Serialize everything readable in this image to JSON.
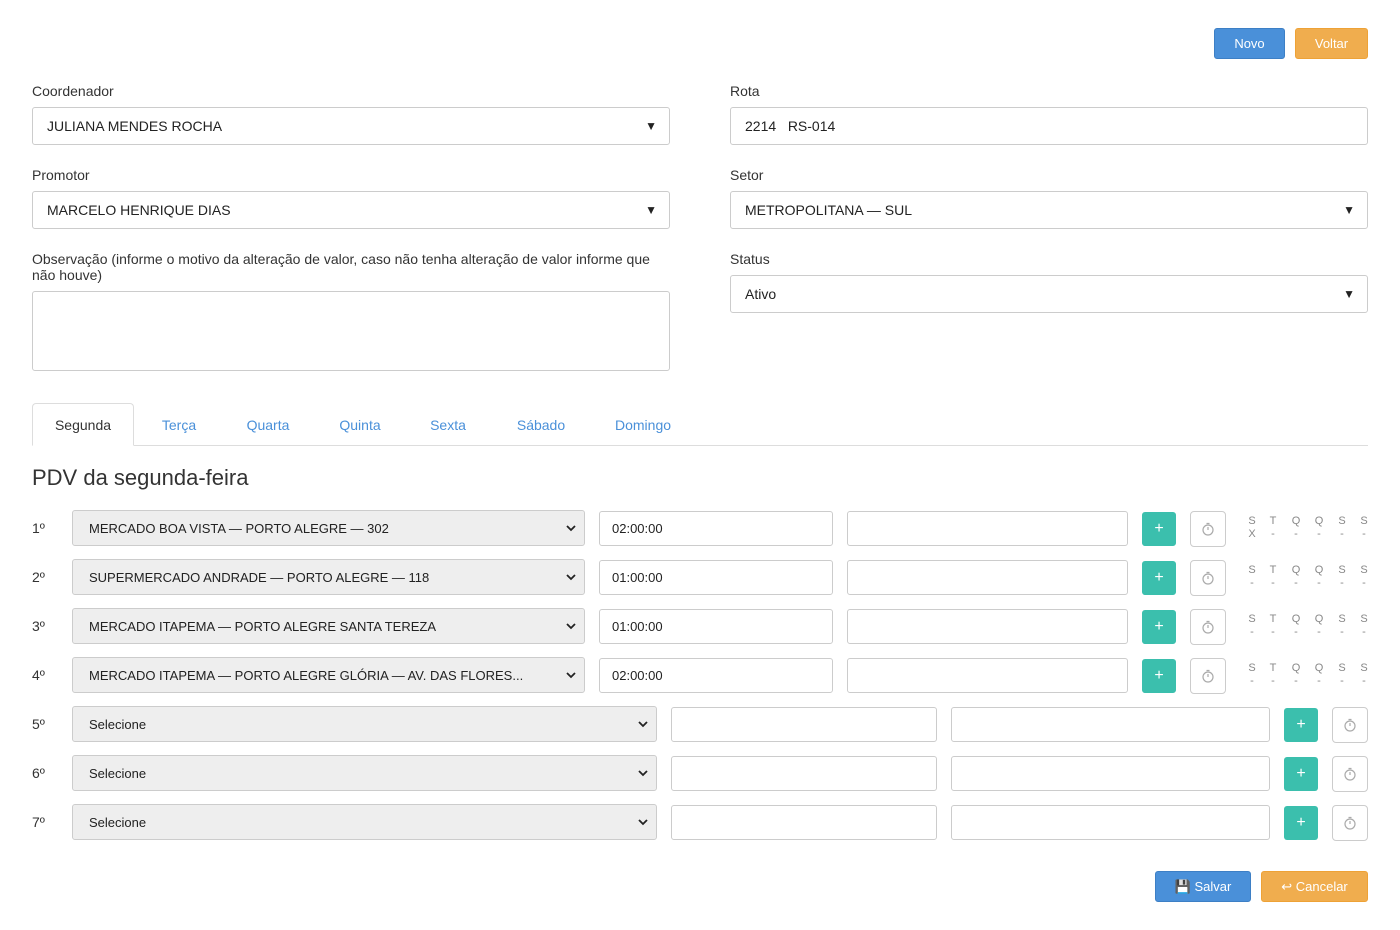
{
  "header": {
    "novo_label": "Novo",
    "voltar_label": "Voltar"
  },
  "form": {
    "coordenador": {
      "label": "Coordenador",
      "value": "JULIANA MENDES ROCHA"
    },
    "rota": {
      "label": "Rota",
      "value": "2214   RS-014"
    },
    "promotor": {
      "label": "Promotor",
      "value": "MARCELO HENRIQUE DIAS"
    },
    "setor": {
      "label": "Setor",
      "value": "METROPOLITANA — SUL"
    },
    "observacao": {
      "label": "Observação (informe o motivo da alteração de valor, caso não tenha alteração de valor informe que não houve)",
      "value": ""
    },
    "status": {
      "label": "Status",
      "value": "Ativo"
    }
  },
  "tabs": [
    "Segunda",
    "Terça",
    "Quarta",
    "Quinta",
    "Sexta",
    "Sábado",
    "Domingo"
  ],
  "section_title": "PDV da segunda-feira",
  "pdv_rows": [
    {
      "num": "1º",
      "pdv": "MERCADO BOA VISTA — PORTO ALEGRE — 302",
      "time": "02:00:00",
      "note": "",
      "day_marks": [
        "X",
        "-",
        "-",
        "-",
        "-",
        "-"
      ]
    },
    {
      "num": "2º",
      "pdv": "SUPERMERCADO ANDRADE — PORTO ALEGRE — 118",
      "time": "01:00:00",
      "note": "",
      "day_marks": [
        "-",
        "-",
        "-",
        "-",
        "-",
        "-"
      ]
    },
    {
      "num": "3º",
      "pdv": "MERCADO ITAPEMA — PORTO ALEGRE SANTA TEREZA",
      "time": "01:00:00",
      "note": "",
      "day_marks": [
        "-",
        "-",
        "-",
        "-",
        "-",
        "-"
      ]
    },
    {
      "num": "4º",
      "pdv": "MERCADO ITAPEMA — PORTO ALEGRE GLÓRIA — AV. DAS FLORES...",
      "time": "02:00:00",
      "note": "",
      "day_marks": [
        "-",
        "-",
        "-",
        "-",
        "-",
        "-"
      ]
    },
    {
      "num": "5º",
      "pdv": "Selecione",
      "time": "",
      "note": ""
    },
    {
      "num": "6º",
      "pdv": "Selecione",
      "time": "",
      "note": ""
    },
    {
      "num": "7º",
      "pdv": "Selecione",
      "time": "",
      "note": ""
    }
  ],
  "day_letters": [
    "S",
    "T",
    "Q",
    "Q",
    "S",
    "S"
  ],
  "footer": {
    "salvar_label": "💾 Salvar",
    "cancelar_label": "↩ Cancelar"
  },
  "icons": {
    "add": "plus-icon",
    "timer": "stopwatch-icon",
    "dropdown": "caret-down-icon"
  },
  "colors": {
    "primary": "#4a90d9",
    "warning": "#f0ad4e",
    "success": "#3bbfad"
  }
}
